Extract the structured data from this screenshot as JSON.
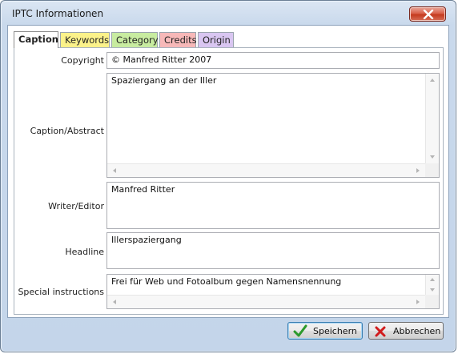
{
  "window": {
    "title": "IPTC Informationen"
  },
  "tabs": [
    {
      "label": "Caption",
      "color": "#ffffff",
      "active": true
    },
    {
      "label": "Keywords",
      "color": "#fbf28a",
      "active": false
    },
    {
      "label": "Category",
      "color": "#c8eca0",
      "active": false
    },
    {
      "label": "Credits",
      "color": "#f7b8b8",
      "active": false
    },
    {
      "label": "Origin",
      "color": "#d9c6f1",
      "active": false
    }
  ],
  "fields": {
    "copyright": {
      "label": "Copyright",
      "value": "© Manfred Ritter 2007"
    },
    "caption_abstract": {
      "label": "Caption/Abstract",
      "value": "Spaziergang an der Iller"
    },
    "writer_editor": {
      "label": "Writer/Editor",
      "value": "Manfred Ritter"
    },
    "headline": {
      "label": "Headline",
      "value": "Illerspaziergang"
    },
    "special_instructions": {
      "label": "Special instructions",
      "value": "Frei für Web und Fotoalbum gegen Namensnennung"
    }
  },
  "buttons": {
    "save": "Speichern",
    "cancel": "Abbrechen"
  },
  "icons": {
    "close": "close-icon",
    "save": "checkmark-icon",
    "cancel": "cross-icon"
  }
}
